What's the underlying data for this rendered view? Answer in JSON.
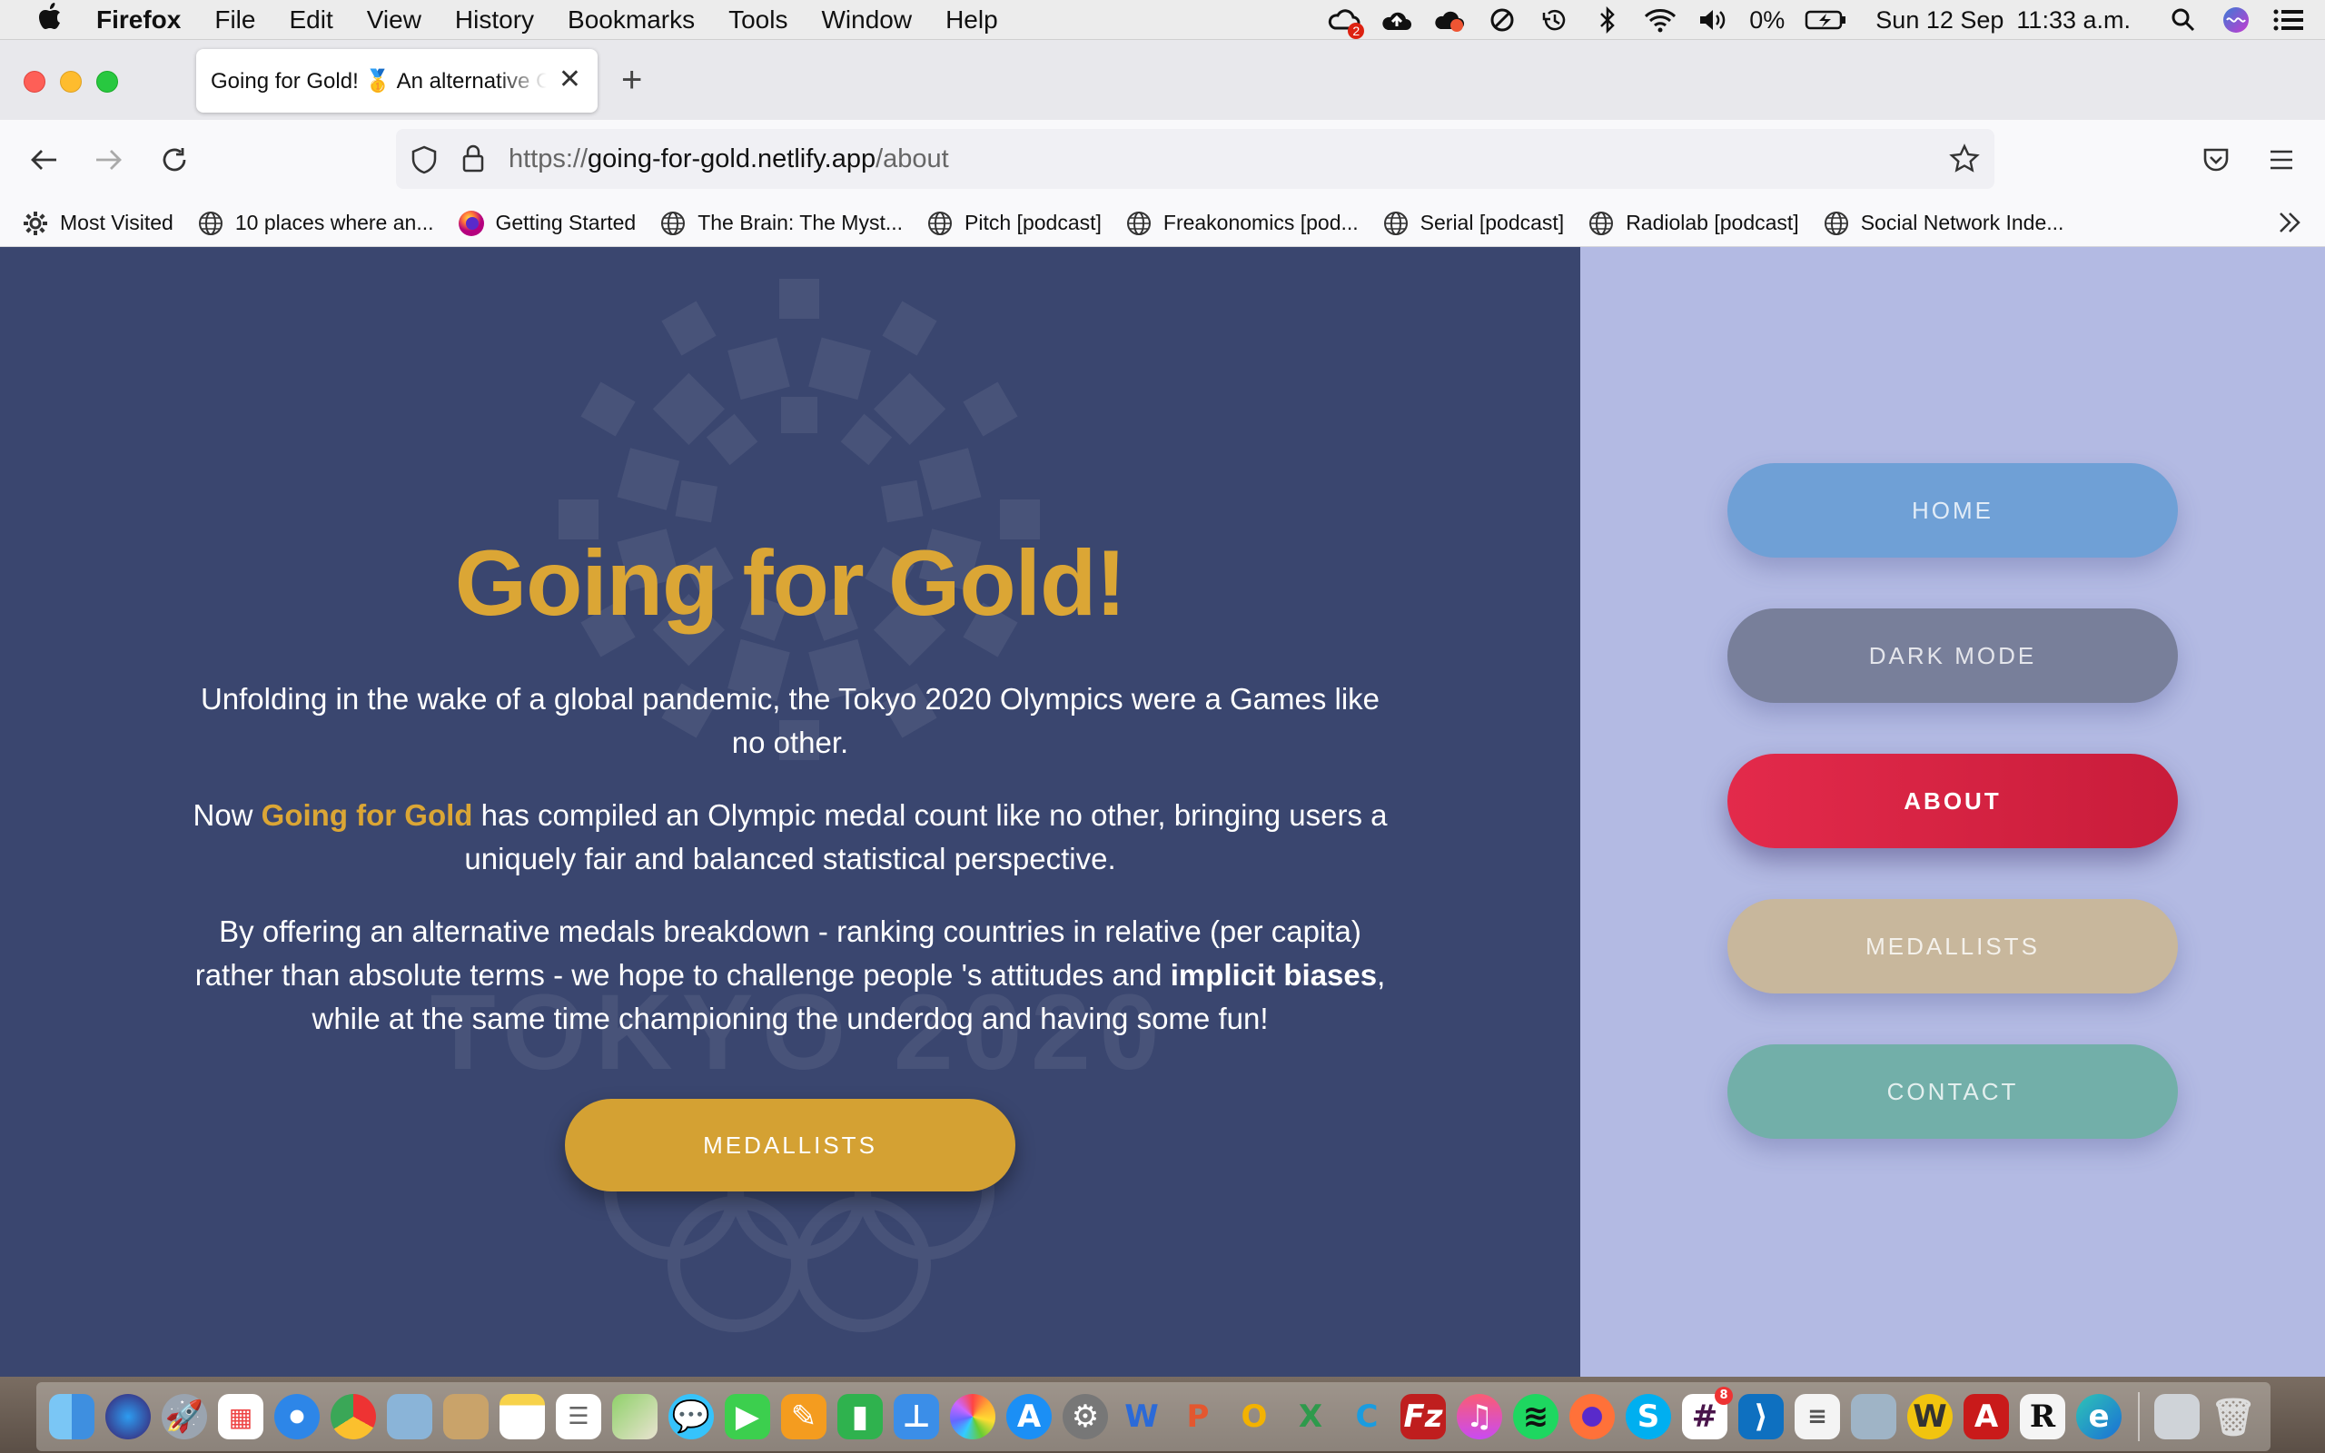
{
  "menubar": {
    "app_name": "Firefox",
    "items": [
      "File",
      "Edit",
      "View",
      "History",
      "Bookmarks",
      "Tools",
      "Window",
      "Help"
    ],
    "battery": "0%",
    "date": "Sun 12 Sep",
    "time": "11:33 a.m.",
    "notification_badge": "2"
  },
  "browser": {
    "tab_title": "Going for Gold! 🥇 An alternative Olympics",
    "url_prefix": "https://",
    "url_host": "going-for-gold.netlify.app",
    "url_path": "/about"
  },
  "bookmarks": [
    {
      "label": "Most Visited",
      "icon": "gear-icon"
    },
    {
      "label": "10 places where an...",
      "icon": "globe-icon"
    },
    {
      "label": "Getting Started",
      "icon": "firefox-icon"
    },
    {
      "label": "The Brain: The Myst...",
      "icon": "globe-icon"
    },
    {
      "label": "Pitch [podcast]",
      "icon": "globe-icon"
    },
    {
      "label": "Freakonomics [pod...",
      "icon": "globe-icon"
    },
    {
      "label": "Serial [podcast]",
      "icon": "globe-icon"
    },
    {
      "label": "Radiolab [podcast]",
      "icon": "globe-icon"
    },
    {
      "label": "Social Network Inde...",
      "icon": "globe-icon"
    }
  ],
  "page": {
    "title": "Going for Gold!",
    "p1": "Unfolding in the wake of a global pandemic, the Tokyo 2020 Olympics were a Games like no other.",
    "p2_before": "Now ",
    "p2_highlight": "Going for Gold",
    "p2_after": " has compiled an Olympic medal count like no other, bringing users a uniquely fair and balanced statistical perspective.",
    "p3_before": "By offering an alternative medals breakdown - ranking countries in relative (per capita) rather than absolute terms - we hope to challenge people 's attitudes and ",
    "p3_bold": "implicit biases",
    "p3_after": ", while at the same time championing the underdog and having some fun!",
    "cta_label": "MEDALLISTS",
    "watermark_text": "TOKYO 2020"
  },
  "sidebar": {
    "home": "HOME",
    "dark_mode": "DARK MODE",
    "about": "ABOUT",
    "medallists": "MEDALLISTS",
    "contact": "CONTACT"
  },
  "colors": {
    "main_bg": "#3a466f",
    "gold": "#dba635",
    "sidebar_bg": "#b3bae3",
    "home": "#6fa0d6",
    "dark_mode": "#787f9a",
    "about": "#dc2244",
    "medallists": "#c8b79c",
    "contact": "#72afa9"
  },
  "dock": {
    "badge_slack": "8"
  }
}
